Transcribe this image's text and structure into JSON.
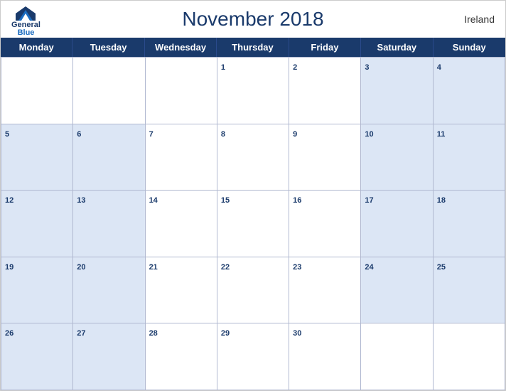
{
  "header": {
    "title": "November 2018",
    "country": "Ireland"
  },
  "logo": {
    "line1": "General",
    "line2": "Blue"
  },
  "days_of_week": [
    "Monday",
    "Tuesday",
    "Wednesday",
    "Thursday",
    "Friday",
    "Saturday",
    "Sunday"
  ],
  "weeks": [
    [
      {
        "date": "",
        "empty": true,
        "blue": false
      },
      {
        "date": "",
        "empty": true,
        "blue": false
      },
      {
        "date": "",
        "empty": true,
        "blue": false
      },
      {
        "date": "1",
        "empty": false,
        "blue": false
      },
      {
        "date": "2",
        "empty": false,
        "blue": false
      },
      {
        "date": "3",
        "empty": false,
        "blue": true
      },
      {
        "date": "4",
        "empty": false,
        "blue": true
      }
    ],
    [
      {
        "date": "5",
        "empty": false,
        "blue": true
      },
      {
        "date": "6",
        "empty": false,
        "blue": true
      },
      {
        "date": "7",
        "empty": false,
        "blue": false
      },
      {
        "date": "8",
        "empty": false,
        "blue": false
      },
      {
        "date": "9",
        "empty": false,
        "blue": false
      },
      {
        "date": "10",
        "empty": false,
        "blue": true
      },
      {
        "date": "11",
        "empty": false,
        "blue": true
      }
    ],
    [
      {
        "date": "12",
        "empty": false,
        "blue": true
      },
      {
        "date": "13",
        "empty": false,
        "blue": true
      },
      {
        "date": "14",
        "empty": false,
        "blue": false
      },
      {
        "date": "15",
        "empty": false,
        "blue": false
      },
      {
        "date": "16",
        "empty": false,
        "blue": false
      },
      {
        "date": "17",
        "empty": false,
        "blue": true
      },
      {
        "date": "18",
        "empty": false,
        "blue": true
      }
    ],
    [
      {
        "date": "19",
        "empty": false,
        "blue": true
      },
      {
        "date": "20",
        "empty": false,
        "blue": true
      },
      {
        "date": "21",
        "empty": false,
        "blue": false
      },
      {
        "date": "22",
        "empty": false,
        "blue": false
      },
      {
        "date": "23",
        "empty": false,
        "blue": false
      },
      {
        "date": "24",
        "empty": false,
        "blue": true
      },
      {
        "date": "25",
        "empty": false,
        "blue": true
      }
    ],
    [
      {
        "date": "26",
        "empty": false,
        "blue": true
      },
      {
        "date": "27",
        "empty": false,
        "blue": true
      },
      {
        "date": "28",
        "empty": false,
        "blue": false
      },
      {
        "date": "29",
        "empty": false,
        "blue": false
      },
      {
        "date": "30",
        "empty": false,
        "blue": false
      },
      {
        "date": "",
        "empty": true,
        "blue": false
      },
      {
        "date": "",
        "empty": true,
        "blue": false
      }
    ]
  ]
}
